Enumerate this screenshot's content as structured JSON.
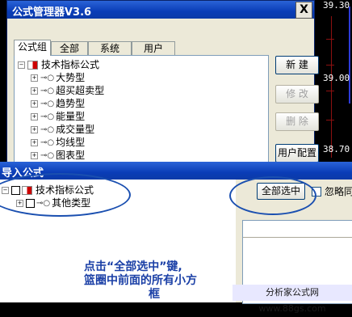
{
  "background_chart": {
    "price_top": "39.30",
    "price_mid": "39.00",
    "price_low": "38.70"
  },
  "manager": {
    "title": "公式管理器V3.6",
    "close_label": "X",
    "tabs": [
      {
        "label": "公式组"
      },
      {
        "label": "全部"
      },
      {
        "label": "系统"
      },
      {
        "label": "用户"
      }
    ],
    "tree_root": "技术指标公式",
    "tree_items": [
      "大势型",
      "超买超卖型",
      "趋势型",
      "能量型",
      "成交量型",
      "均线型",
      "图表型"
    ],
    "buttons": {
      "new": "新 建",
      "modify": "修 改",
      "delete": "删 除",
      "user_config": "用户配置"
    }
  },
  "import": {
    "title": "导入公式",
    "tree_root": "技术指标公式",
    "tree_child": "其他类型",
    "select_all_button": "全部选中",
    "ignore_label": "忽略同"
  },
  "annotation": {
    "line1": "点击“全部选中”键,",
    "line2": "篮圈中前面的所有小方",
    "line3": "框"
  },
  "watermark": "分析家公式网www.88gs.com",
  "colors": {
    "titlebar": "#0a3db7",
    "annotation": "#1a4fb0"
  }
}
